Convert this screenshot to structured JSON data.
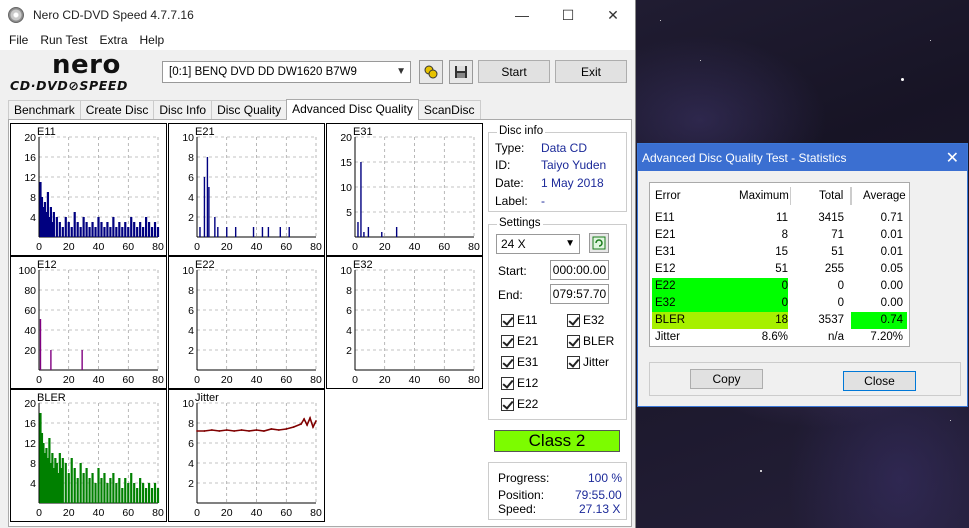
{
  "window": {
    "title": "Nero CD-DVD Speed 4.7.7.16",
    "minimize_glyph": "—",
    "maximize_glyph": "☐",
    "close_glyph": "✕"
  },
  "menu": [
    "File",
    "Run Test",
    "Extra",
    "Help"
  ],
  "logo": {
    "brand": "nero",
    "product": "CD·DVD⊘SPEED"
  },
  "toolbar": {
    "drive": "[0:1]  BENQ DVD DD DW1620 B7W9",
    "start_label": "Start",
    "exit_label": "Exit",
    "icons": [
      "drive-info-icon",
      "save-icon"
    ]
  },
  "tabs": [
    "Benchmark",
    "Create Disc",
    "Disc Info",
    "Disc Quality",
    "Advanced Disc Quality",
    "ScanDisc"
  ],
  "active_tab": "Advanced Disc Quality",
  "disc_info": {
    "group_label": "Disc info",
    "type_label": "Type:",
    "type": "Data CD",
    "id_label": "ID:",
    "id": "Taiyo Yuden",
    "date_label": "Date:",
    "date": "1 May 2018",
    "label_label": "Label:",
    "label": "-"
  },
  "settings": {
    "group_label": "Settings",
    "speed": "24 X",
    "start_label": "Start:",
    "start": "000:00.00",
    "end_label": "End:",
    "end": "079:57.70",
    "checkboxes": {
      "e11": "E11",
      "e32": "E32",
      "e21": "E21",
      "bler": "BLER",
      "e31": "E31",
      "jitter": "Jitter",
      "e12": "E12",
      "e22": "E22"
    }
  },
  "class_label": "Class 2",
  "progress": {
    "progress_label": "Progress:",
    "progress": "100 %",
    "position_label": "Position:",
    "position": "79:55.00",
    "speed_label": "Speed:",
    "speed": "27.13 X"
  },
  "colors": {
    "navy": "#000080",
    "green_bars": "#008000",
    "jitter": "#800000",
    "class_badge": "#7cfc00",
    "highlight": "#00ff00",
    "bler_avg": "#a6f000"
  },
  "chart_data": [
    {
      "name": "E11",
      "type": "bar",
      "ylim": [
        0,
        20
      ],
      "yticks": [
        4,
        8,
        12,
        16,
        20
      ],
      "xticks": [
        0,
        20,
        40,
        60,
        80
      ],
      "color": "#000080",
      "x": [
        1,
        2,
        3,
        4,
        5,
        6,
        7,
        8,
        9,
        10,
        12,
        14,
        16,
        18,
        20,
        22,
        24,
        26,
        28,
        30,
        32,
        34,
        36,
        38,
        40,
        42,
        44,
        46,
        48,
        50,
        52,
        54,
        56,
        58,
        60,
        62,
        64,
        66,
        68,
        70,
        72,
        74,
        76,
        78,
        80
      ],
      "values": [
        11,
        8,
        6,
        7,
        5,
        9,
        4,
        6,
        3,
        5,
        4,
        3,
        2,
        4,
        3,
        2,
        5,
        3,
        2,
        4,
        3,
        2,
        3,
        2,
        4,
        3,
        2,
        3,
        2,
        4,
        2,
        3,
        2,
        3,
        2,
        4,
        3,
        2,
        3,
        2,
        4,
        3,
        2,
        3,
        2
      ]
    },
    {
      "name": "E21",
      "type": "bar",
      "ylim": [
        0,
        10
      ],
      "yticks": [
        2,
        4,
        6,
        8,
        10
      ],
      "xticks": [
        0,
        20,
        40,
        60,
        80
      ],
      "color": "#000080",
      "x": [
        2,
        5,
        7,
        8,
        12,
        14,
        20,
        26,
        38,
        44,
        48,
        56,
        62
      ],
      "values": [
        1,
        6,
        8,
        5,
        2,
        1,
        1,
        1,
        1,
        1,
        1,
        1,
        1
      ]
    },
    {
      "name": "E31",
      "type": "bar",
      "ylim": [
        0,
        20
      ],
      "yticks": [
        5,
        10,
        15,
        20
      ],
      "xticks": [
        0,
        20,
        40,
        60,
        80
      ],
      "color": "#000080",
      "x": [
        2,
        4,
        6,
        9,
        18,
        28
      ],
      "values": [
        3,
        15,
        1,
        2,
        1,
        2
      ]
    },
    {
      "name": "E12",
      "type": "bar",
      "ylim": [
        0,
        100
      ],
      "yticks": [
        20,
        40,
        60,
        80,
        100
      ],
      "xticks": [
        0,
        20,
        40,
        60,
        80
      ],
      "color": "#800080",
      "x": [
        1,
        8,
        29
      ],
      "values": [
        51,
        20,
        20
      ]
    },
    {
      "name": "E22",
      "type": "bar",
      "ylim": [
        0,
        10
      ],
      "yticks": [
        2,
        4,
        6,
        8,
        10
      ],
      "xticks": [
        0,
        20,
        40,
        60,
        80
      ],
      "color": "#000080",
      "x": [],
      "values": []
    },
    {
      "name": "E32",
      "type": "bar",
      "ylim": [
        0,
        10
      ],
      "yticks": [
        2,
        4,
        6,
        8,
        10
      ],
      "xticks": [
        0,
        20,
        40,
        60,
        80
      ],
      "color": "#000080",
      "x": [],
      "values": []
    },
    {
      "name": "BLER",
      "type": "bar",
      "ylim": [
        0,
        20
      ],
      "yticks": [
        4,
        8,
        12,
        16,
        20
      ],
      "xticks": [
        0,
        20,
        40,
        60,
        80
      ],
      "color": "#008000",
      "x": [
        1,
        2,
        3,
        4,
        5,
        6,
        7,
        8,
        9,
        10,
        11,
        12,
        13,
        14,
        15,
        16,
        18,
        20,
        22,
        24,
        26,
        28,
        30,
        32,
        34,
        36,
        38,
        40,
        42,
        44,
        46,
        48,
        50,
        52,
        54,
        56,
        58,
        60,
        62,
        64,
        66,
        68,
        70,
        72,
        74,
        76,
        78,
        80
      ],
      "values": [
        18,
        14,
        12,
        10,
        11,
        9,
        13,
        8,
        10,
        7,
        9,
        8,
        6,
        10,
        7,
        9,
        8,
        6,
        9,
        7,
        5,
        8,
        6,
        7,
        5,
        6,
        4,
        7,
        5,
        6,
        4,
        5,
        6,
        4,
        5,
        3,
        5,
        4,
        6,
        4,
        3,
        5,
        4,
        3,
        4,
        3,
        4,
        3
      ]
    },
    {
      "name": "Jitter",
      "type": "line",
      "ylim": [
        0,
        10
      ],
      "yticks": [
        2,
        4,
        6,
        8,
        10
      ],
      "xticks": [
        0,
        20,
        40,
        60,
        80
      ],
      "color": "#800000",
      "x": [
        0,
        5,
        10,
        15,
        20,
        25,
        30,
        35,
        40,
        45,
        50,
        55,
        60,
        65,
        70,
        72,
        74,
        76,
        78,
        80
      ],
      "values": [
        7.2,
        7.2,
        7.3,
        7.2,
        7.3,
        7.2,
        7.3,
        7.2,
        7.3,
        7.2,
        7.4,
        7.3,
        7.4,
        7.6,
        7.9,
        8.4,
        7.8,
        8.5,
        7.6,
        8.2
      ]
    }
  ],
  "stats": {
    "title": "Advanced Disc Quality Test - Statistics",
    "close_glyph": "✕",
    "headers": [
      "Error",
      "Maximum",
      "Total",
      "Average"
    ],
    "rows": [
      {
        "error": "E11",
        "maximum": "11",
        "total": "3415",
        "average": "0.71"
      },
      {
        "error": "E21",
        "maximum": "8",
        "total": "71",
        "average": "0.01"
      },
      {
        "error": "E31",
        "maximum": "15",
        "total": "51",
        "average": "0.01"
      },
      {
        "error": "E12",
        "maximum": "51",
        "total": "255",
        "average": "0.05"
      },
      {
        "error": "E22",
        "maximum": "0",
        "total": "0",
        "average": "0.00"
      },
      {
        "error": "E32",
        "maximum": "0",
        "total": "0",
        "average": "0.00"
      },
      {
        "error": "BLER",
        "maximum": "18",
        "total": "3537",
        "average": "0.74"
      },
      {
        "error": "Jitter",
        "maximum": "8.6%",
        "total": "n/a",
        "average": "7.20%"
      }
    ],
    "copy_label": "Copy",
    "close_label": "Close"
  }
}
